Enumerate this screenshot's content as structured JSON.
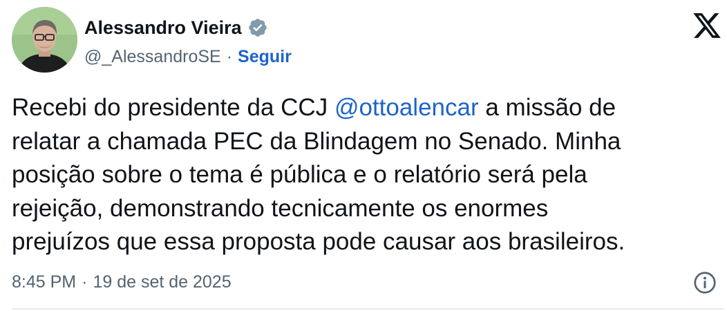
{
  "author": {
    "display_name": "Alessandro Vieira",
    "handle": "@_AlessandroSE",
    "separator": "·",
    "follow_label": "Seguir",
    "verified_icon": "verified-badge-icon",
    "avatar": "avatar-photo"
  },
  "brand": {
    "logo_icon": "x-logo-icon"
  },
  "tweet": {
    "lines": [
      {
        "before": "Recebi do presidente da CCJ ",
        "mention": "@ottoalencar",
        "after": " a missão de"
      },
      {
        "text": "relatar a chamada PEC da Blindagem no Senado. Minha"
      },
      {
        "text": "posição sobre o tema é pública e o relatório será pela"
      },
      {
        "text": "rejeição, demonstrando tecnicamente os enormes"
      },
      {
        "text": "prejuízos que essa proposta pode causar aos brasileiros."
      }
    ]
  },
  "meta": {
    "time": "8:45 PM",
    "separator": "·",
    "date": "19 de set de 2025",
    "info_icon": "info-icon"
  },
  "colors": {
    "text": "#0f1419",
    "secondary": "#536471",
    "link": "#1d64c9",
    "verified": "#829aab",
    "divider": "#e6e9ec"
  }
}
